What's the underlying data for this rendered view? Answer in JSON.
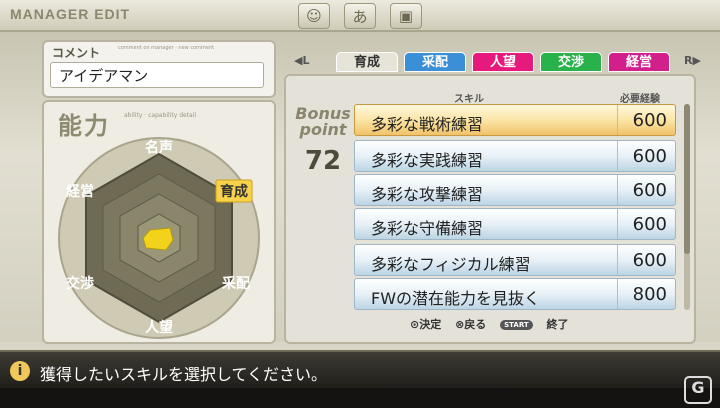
{
  "header": {
    "title": "MANAGER EDIT",
    "icons": [
      "face-icon",
      "hiragana-a-icon",
      "briefcase-icon"
    ],
    "icon_glyphs": [
      "☺",
      "あ",
      "▣"
    ]
  },
  "comment": {
    "label": "コメント",
    "sublabel": "comment on manager · new comment",
    "value": "アイデアマン"
  },
  "ability": {
    "title": "能力",
    "sublabel": "ability · capability detail",
    "axes": [
      "名声",
      "育成",
      "采配",
      "人望",
      "交渉",
      "経営"
    ],
    "highlighted_axis": "育成"
  },
  "tabs": {
    "left_key": "L",
    "right_key": "R",
    "items": [
      {
        "label": "育成",
        "color": "#e6e3d8",
        "text": "#333",
        "active": true
      },
      {
        "label": "采配",
        "color": "#3a8fd6",
        "text": "#ffffff",
        "active": false
      },
      {
        "label": "人望",
        "color": "#e6197d",
        "text": "#ffffff",
        "active": false
      },
      {
        "label": "交渉",
        "color": "#2ab24a",
        "text": "#ffffff",
        "active": false
      },
      {
        "label": "経営",
        "color": "#d21f8c",
        "text": "#ffffff",
        "active": false
      }
    ]
  },
  "bonus": {
    "label_line1": "Bonus",
    "label_line2": "point",
    "value": "72"
  },
  "skills": {
    "col_skill": "スキル",
    "col_cost": "必要経験",
    "rows": [
      {
        "name": "多彩な戦術練習",
        "cost": "600",
        "selected": true
      },
      {
        "name": "多彩な実践練習",
        "cost": "600",
        "selected": false
      },
      {
        "name": "多彩な攻撃練習",
        "cost": "600",
        "selected": false
      },
      {
        "name": "多彩な守備練習",
        "cost": "600",
        "selected": false
      },
      {
        "name": "多彩なフィジカル練習",
        "cost": "600",
        "selected": false
      },
      {
        "name": "FWの潜在能力を見抜く",
        "cost": "800",
        "selected": false
      }
    ]
  },
  "controls": {
    "confirm": "⊙決定",
    "back": "⊗戻る",
    "start": "START",
    "end": "終了"
  },
  "message": {
    "text": "獲得したいスキルを選択してください。"
  },
  "watermark": "G"
}
